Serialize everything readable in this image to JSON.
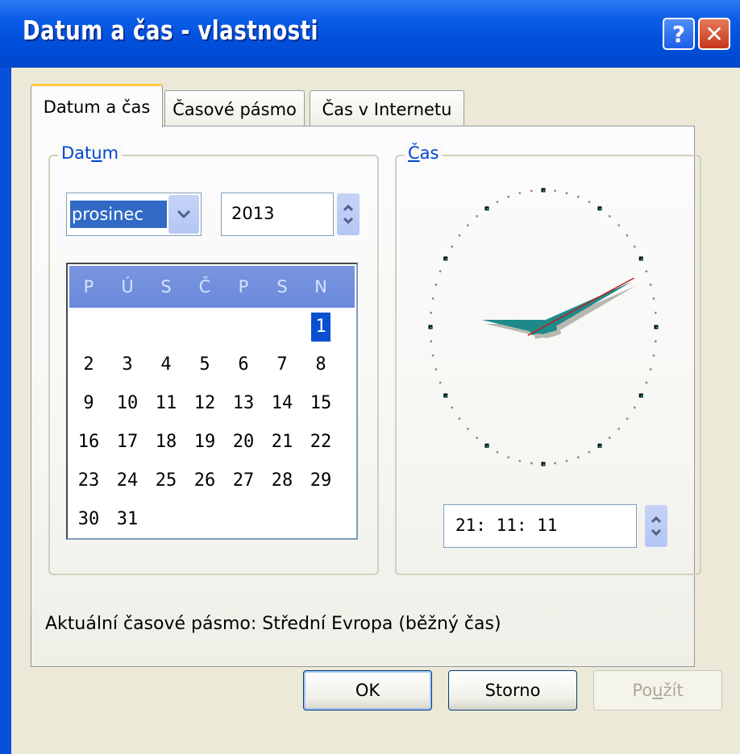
{
  "window": {
    "title": "Datum a čas - vlastnosti",
    "help_glyph": "?",
    "close_glyph": "✕"
  },
  "tabs": [
    {
      "label": "Datum a čas",
      "active": true
    },
    {
      "label": "Časové pásmo",
      "active": false
    },
    {
      "label": "Čas v Internetu",
      "active": false
    }
  ],
  "date_group": {
    "label_pre": "Dat",
    "label_mnemonic": "u",
    "label_post": "m",
    "month": "prosinec",
    "year": "2013"
  },
  "calendar": {
    "day_names": [
      "P",
      "Ú",
      "S",
      "Č",
      "P",
      "S",
      "N"
    ],
    "weeks": [
      [
        "",
        "",
        "",
        "",
        "",
        "",
        "1"
      ],
      [
        "2",
        "3",
        "4",
        "5",
        "6",
        "7",
        "8"
      ],
      [
        "9",
        "10",
        "11",
        "12",
        "13",
        "14",
        "15"
      ],
      [
        "16",
        "17",
        "18",
        "19",
        "20",
        "21",
        "22"
      ],
      [
        "23",
        "24",
        "25",
        "26",
        "27",
        "28",
        "29"
      ],
      [
        "30",
        "31",
        "",
        "",
        "",
        "",
        ""
      ]
    ],
    "selected_day": "1"
  },
  "time_group": {
    "label_mnemonic": "Č",
    "label_post": "as",
    "time": "21: 11: 11",
    "clock_hours": 21,
    "clock_minutes": 11,
    "clock_seconds": 11
  },
  "timezone": {
    "text": "Aktuální časové pásmo:  Střední Evropa (běžný čas)"
  },
  "buttons": {
    "ok": "OK",
    "cancel": "Storno",
    "apply_pre": "Po",
    "apply_mnemonic": "u",
    "apply_post": "žít"
  },
  "colors": {
    "accent": "#0a4fd0",
    "hand": "#1f8a8a"
  }
}
